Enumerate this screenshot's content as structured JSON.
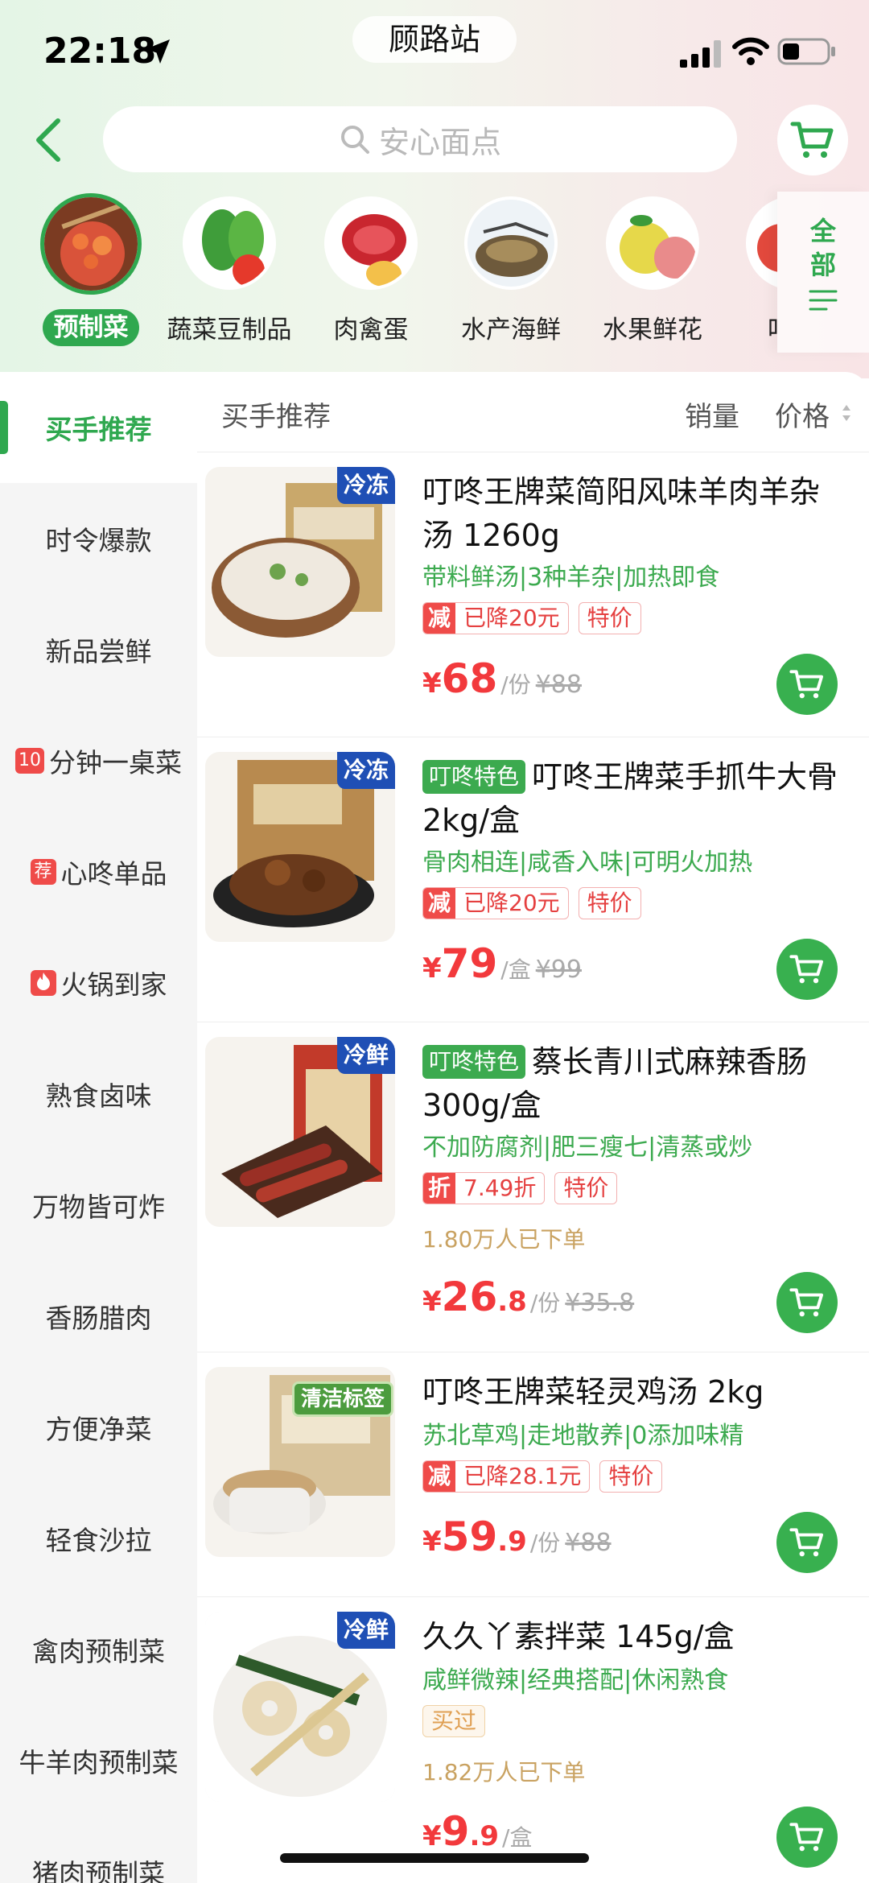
{
  "status_bar": {
    "time": "22:18",
    "location_title": "顾路站"
  },
  "header": {
    "search_placeholder": "安心面点"
  },
  "categories": [
    {
      "label": "预制菜",
      "active": true
    },
    {
      "label": "蔬菜豆制品",
      "active": false
    },
    {
      "label": "肉禽蛋",
      "active": false
    },
    {
      "label": "水产海鲜",
      "active": false
    },
    {
      "label": "水果鲜花",
      "active": false
    },
    {
      "label": "叮咚",
      "active": false
    }
  ],
  "all_categories": {
    "line1": "全",
    "line2": "部"
  },
  "sidebar": {
    "items": [
      {
        "label": "买手推荐",
        "badge": "",
        "active": true
      },
      {
        "label": "时令爆款",
        "badge": ""
      },
      {
        "label": "新品尝鲜",
        "badge": ""
      },
      {
        "label": "分钟一桌菜",
        "badge": "10"
      },
      {
        "label": "心咚单品",
        "badge": "荐"
      },
      {
        "label": "火锅到家",
        "badge": "fire"
      },
      {
        "label": "熟食卤味",
        "badge": ""
      },
      {
        "label": "万物皆可炸",
        "badge": ""
      },
      {
        "label": "香肠腊肉",
        "badge": ""
      },
      {
        "label": "方便净菜",
        "badge": ""
      },
      {
        "label": "轻食沙拉",
        "badge": ""
      },
      {
        "label": "禽肉预制菜",
        "badge": ""
      },
      {
        "label": "牛羊肉预制菜",
        "badge": ""
      },
      {
        "label": "猪肉预制菜",
        "badge": ""
      }
    ]
  },
  "sort_bar": {
    "title": "买手推荐",
    "sales": "销量",
    "price": "价格"
  },
  "products": [
    {
      "img_tag": "冷冻",
      "title_tag": "",
      "title": "叮咚王牌菜简阳风味羊肉羊杂汤 1260g",
      "features": "带料鲜汤|3种羊杂|加热即食",
      "promo_key": "减",
      "promo_text": "已降20元",
      "promo_extra": "特价",
      "sold": "",
      "price_int": "68",
      "price_dec": "",
      "unit": "/份",
      "orig": "¥88"
    },
    {
      "img_tag": "冷冻",
      "title_tag": "叮咚特色",
      "title": "叮咚王牌菜手抓牛大骨 2kg/盒",
      "features": "骨肉相连|咸香入味|可明火加热",
      "promo_key": "减",
      "promo_text": "已降20元",
      "promo_extra": "特价",
      "sold": "",
      "price_int": "79",
      "price_dec": "",
      "unit": "/盒",
      "orig": "¥99"
    },
    {
      "img_tag": "冷鲜",
      "title_tag": "叮咚特色",
      "title": "蔡长青川式麻辣香肠 300g/盒",
      "features": "不加防腐剂|肥三瘦七|清蒸或炒",
      "promo_key": "折",
      "promo_text": "7.49折",
      "promo_extra": "特价",
      "sold": "1.80万人已下单",
      "price_int": "26",
      "price_dec": ".8",
      "unit": "/份",
      "orig": "¥35.8"
    },
    {
      "img_tag": "清洁标签",
      "title_tag": "",
      "title": "叮咚王牌菜轻灵鸡汤 2kg",
      "features": "苏北草鸡|走地散养|0添加味精",
      "promo_key": "减",
      "promo_text": "已降28.1元",
      "promo_extra": "特价",
      "sold": "",
      "price_int": "59",
      "price_dec": ".9",
      "unit": "/份",
      "orig": "¥88"
    },
    {
      "img_tag": "冷鲜",
      "title_tag": "",
      "title": "久久丫素拌菜 145g/盒",
      "features": "咸鲜微辣|经典搭配|休闲熟食",
      "bought": "买过",
      "sold": "1.82万人已下单",
      "price_int": "9",
      "price_dec": ".9",
      "unit": "/盒",
      "orig": ""
    }
  ],
  "colors": {
    "accent": "#2fa84f",
    "price": "#f2393c",
    "frozen_tag": "#1f4fb5"
  },
  "currency": "¥"
}
